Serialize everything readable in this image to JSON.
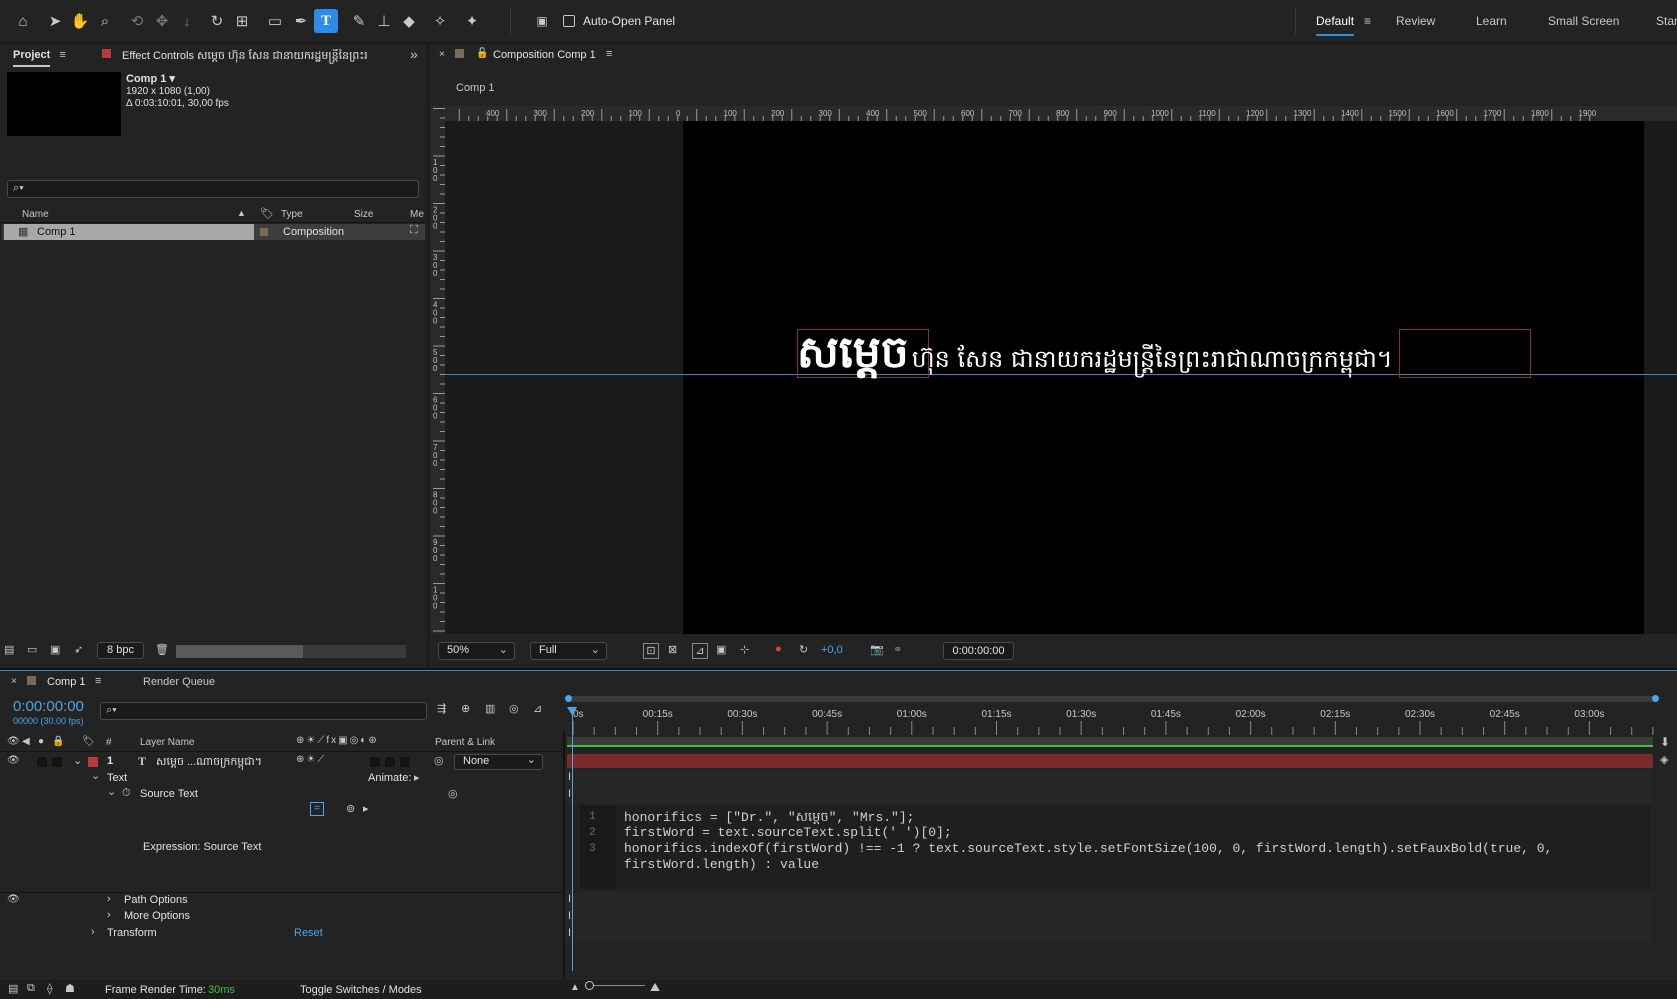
{
  "toolbar": {
    "tools": [
      "home-icon",
      "selection-icon",
      "hand-icon",
      "zoom-icon",
      "orbit-icon",
      "pan-behind-icon",
      "dolly-icon",
      "rotate-icon",
      "anchor-icon",
      "rectangle-icon",
      "pen-icon",
      "type-icon",
      "brush-icon",
      "clone-stamp-icon",
      "eraser-icon",
      "roto-brush-icon",
      "puppet-pin-icon"
    ],
    "auto_open_label": "Auto-Open Panel",
    "workspaces": [
      "Default",
      "Review",
      "Learn",
      "Small Screen",
      "Stan"
    ],
    "active_workspace": "Default"
  },
  "project": {
    "tab_label": "Project",
    "effect_controls_label": "Effect Controls សម្តេច ហ៊ុន សែន ជានាយករដ្ឋមន្ត្រីនៃព្រះរ",
    "comp_name": "Comp 1",
    "comp_dims": "1920 x 1080 (1,00)",
    "comp_duration": "Δ 0:03:10:01, 30,00 fps",
    "search_placeholder": "",
    "columns": [
      "Name",
      "Type",
      "Size",
      "Me"
    ],
    "items": [
      {
        "name": "Comp 1",
        "type": "Composition"
      }
    ],
    "bpc_label": "8 bpc"
  },
  "composition": {
    "tab_label": "Composition Comp 1",
    "breadcrumb": "Comp 1",
    "ruler_labels": [
      "400",
      "300",
      "200",
      "100",
      "0",
      "100",
      "200",
      "300",
      "400",
      "500",
      "600",
      "700",
      "800",
      "900",
      "1000",
      "1100",
      "1200",
      "1300",
      "1400",
      "1500",
      "1600",
      "1700",
      "1800",
      "1900"
    ],
    "vruler_labels": [
      "100",
      "200",
      "300",
      "400",
      "500",
      "600",
      "700",
      "800",
      "900",
      "100"
    ],
    "text_big": "សម្តេច",
    "text_rest": "ហ៊ុន សែន ជានាយករដ្ឋមន្ត្រីនៃព្រះរាជាណាចក្រកម្ពុជា។",
    "zoom": "50%",
    "resolution": "Full",
    "exposure": "+0,0",
    "timecode": "0:00:00:00"
  },
  "timeline": {
    "tab_label": "Comp 1",
    "render_queue_label": "Render Queue",
    "current_time": "0:00:00:00",
    "frame_info": "00000 (30.00 fps)",
    "col_layer_name": "Layer Name",
    "col_parent": "Parent & Link",
    "col_num": "#",
    "layer_num": "1",
    "layer_name": "សម្តេច ...ណាចក្រកម្ពុជា។",
    "parent_value": "None",
    "text_group": "Text",
    "animate_label": "Animate:",
    "source_text": "Source Text",
    "expression_label": "Expression: Source Text",
    "path_options": "Path Options",
    "more_options": "More Options",
    "transform": "Transform",
    "reset_label": "Reset",
    "time_ticks": [
      "0s",
      "00:15s",
      "00:30s",
      "00:45s",
      "01:00s",
      "01:15s",
      "01:30s",
      "01:45s",
      "02:00s",
      "02:15s",
      "02:30s",
      "02:45s",
      "03:00s"
    ],
    "frame_render_label": "Frame Render Time:",
    "frame_render_value": "30ms",
    "toggle_label": "Toggle Switches / Modes",
    "code_lines": [
      "honorifics = [\"Dr.\", \"សម្តេច\", \"Mrs.\"];",
      "firstWord = text.sourceText.split(' ')[0];",
      "honorifics.indexOf(firstWord) !== -1 ? text.sourceText.style.setFontSize(100, 0, firstWord.length).setFauxBold(true, 0,",
      "firstWord.length) : value"
    ],
    "line_numbers": [
      "1",
      "2",
      "3"
    ]
  },
  "colors": {
    "accent": "#2d8ceb",
    "layer_bar": "#7a2a2a",
    "work_area": "#3fbf3f"
  }
}
